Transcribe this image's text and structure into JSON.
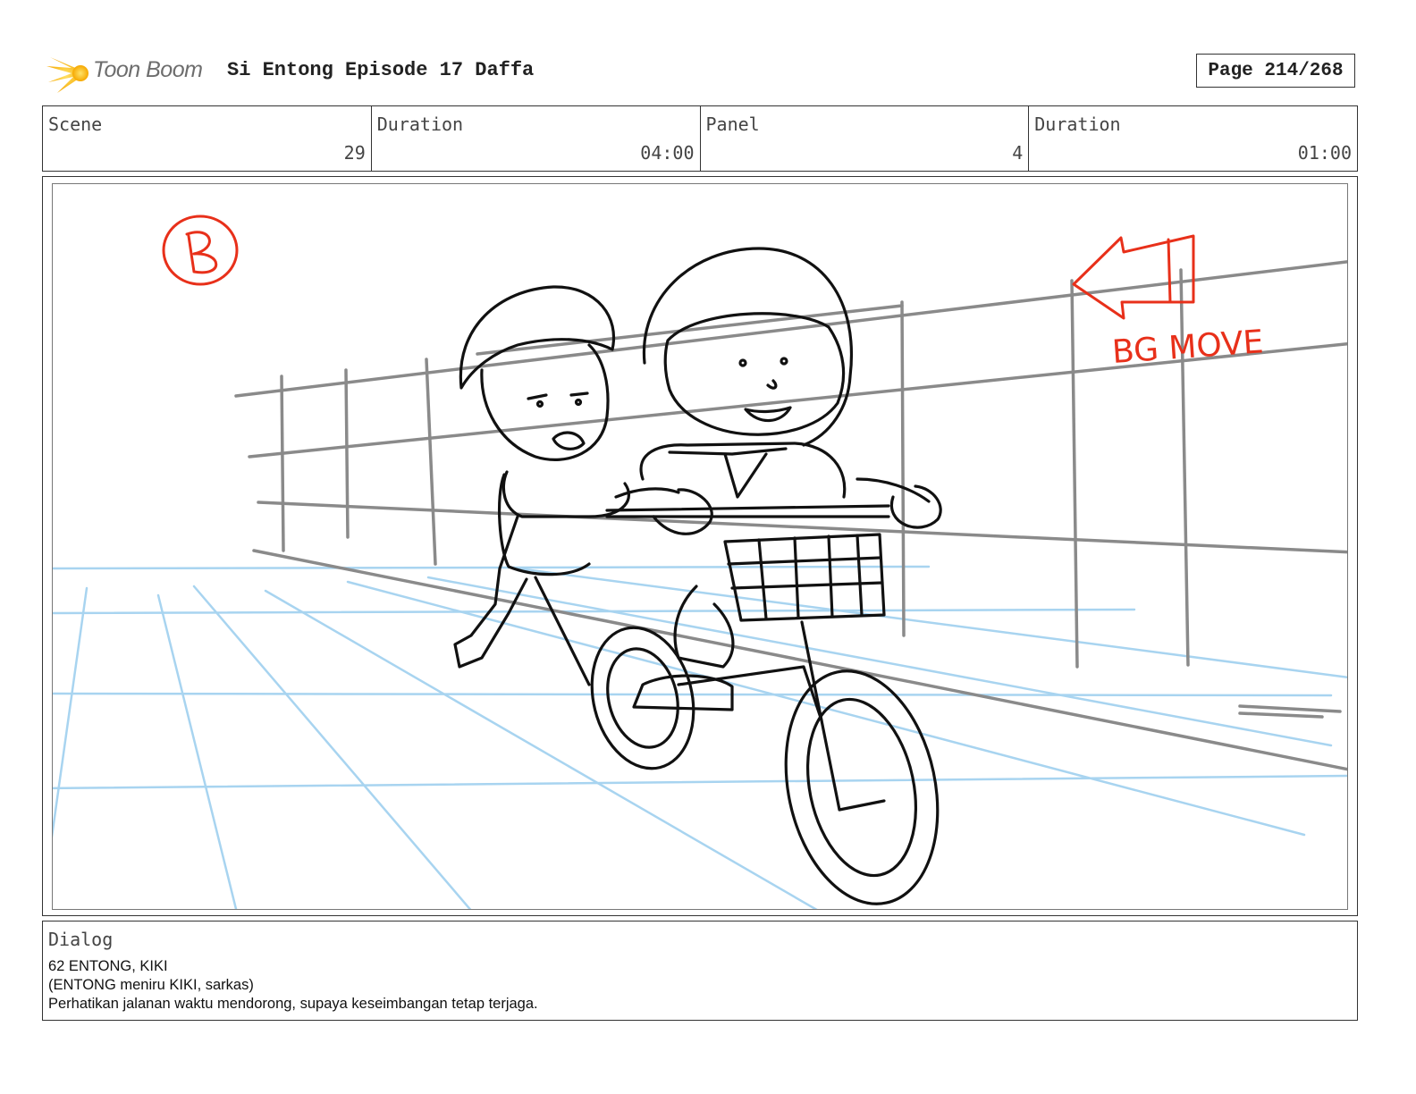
{
  "header": {
    "brand": "Toon Boom",
    "title": "Si Entong Episode 17 Daffa",
    "page": "Page 214/268"
  },
  "info": [
    {
      "label": "Scene",
      "value": "29"
    },
    {
      "label": "Duration",
      "value": "04:00"
    },
    {
      "label": "Panel",
      "value": "4"
    },
    {
      "label": "Duration",
      "value": "01:00"
    }
  ],
  "panel": {
    "annotation_letter": "B",
    "annotation_note": "BG MOVE",
    "colors": {
      "construction": "#a8d4f0",
      "background": "#8a8a8a",
      "ink": "#111111",
      "annotation": "#e8301a"
    }
  },
  "dialog": {
    "label": "Dialog",
    "lines": [
      "62 ENTONG, KIKI",
      "(ENTONG meniru KIKI, sarkas)",
      "Perhatikan jalanan waktu mendorong, supaya keseimbangan tetap terjaga."
    ]
  },
  "logo_icon": "toon-boom-star-icon"
}
